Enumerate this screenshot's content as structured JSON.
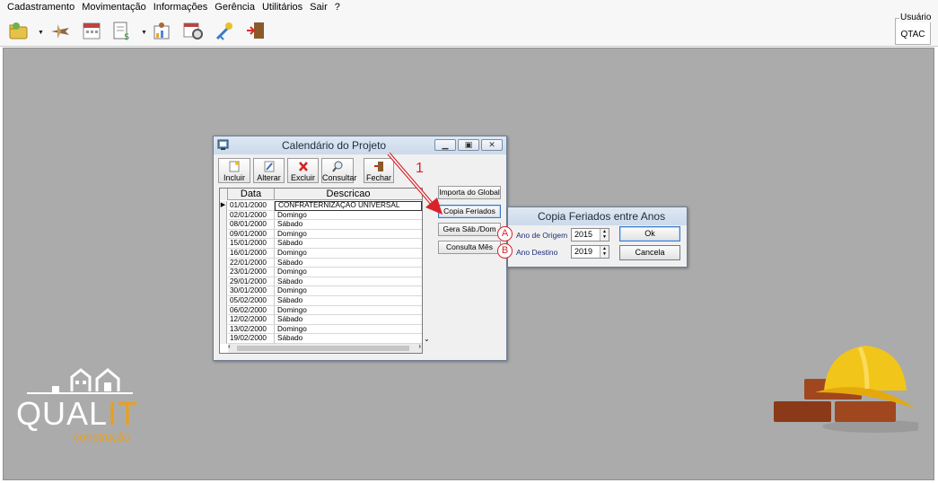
{
  "menubar": {
    "items": [
      "Cadastramento",
      "Movimentação",
      "Informações",
      "Gerência",
      "Utilitários",
      "Sair",
      "?"
    ]
  },
  "toolbar": {
    "icons": [
      "folder-person-icon",
      "airplane-icon",
      "calendar-icon",
      "document-money-icon",
      "chart-person-icon",
      "calendar-clock-icon",
      "key-icon",
      "exit-door-icon"
    ]
  },
  "user_box": {
    "label": "Usuário",
    "value": "QTAC"
  },
  "calendar_window": {
    "title": "Calendário do Projeto",
    "buttons": {
      "incluir": "Incluir",
      "alterar": "Alterar",
      "excluir": "Excluir",
      "consultar": "Consultar",
      "fechar": "Fechar"
    },
    "grid": {
      "columns": [
        "Data",
        "Descricao"
      ],
      "rows": [
        [
          "01/01/2000",
          "CONFRATERNIZAÇÃO UNIVERSAL"
        ],
        [
          "02/01/2000",
          "Domingo"
        ],
        [
          "08/01/2000",
          "Sábado"
        ],
        [
          "09/01/2000",
          "Domingo"
        ],
        [
          "15/01/2000",
          "Sábado"
        ],
        [
          "16/01/2000",
          "Domingo"
        ],
        [
          "22/01/2000",
          "Sábado"
        ],
        [
          "23/01/2000",
          "Domingo"
        ],
        [
          "29/01/2000",
          "Sábado"
        ],
        [
          "30/01/2000",
          "Domingo"
        ],
        [
          "05/02/2000",
          "Sábado"
        ],
        [
          "06/02/2000",
          "Domingo"
        ],
        [
          "12/02/2000",
          "Sábado"
        ],
        [
          "13/02/2000",
          "Domingo"
        ],
        [
          "19/02/2000",
          "Sábado"
        ]
      ]
    },
    "side_buttons": {
      "importa": "Importa do Global",
      "copia": "Copia Feriados",
      "gera": "Gera Sáb./Dom",
      "consulta_mes": "Consulta Mês"
    }
  },
  "copy_dialog": {
    "title": "Copia Feriados entre Anos",
    "ano_origem_label": "Ano de Origem",
    "ano_origem_value": "2015",
    "ano_destino_label": "Ano Destino",
    "ano_destino_value": "2019",
    "ok_label": "Ok",
    "cancel_label": "Cancela"
  },
  "annotations": {
    "arrow_number": "1",
    "marker_a": "A",
    "marker_b": "B"
  },
  "logo": {
    "brand_main": "QUAL",
    "brand_accent": "IT",
    "brand_sub": "construção"
  },
  "colors": {
    "desktop": "#ababab",
    "accent_red": "#d8232a",
    "brand_orange": "#e8a020",
    "label_blue": "#1a2e7a"
  }
}
